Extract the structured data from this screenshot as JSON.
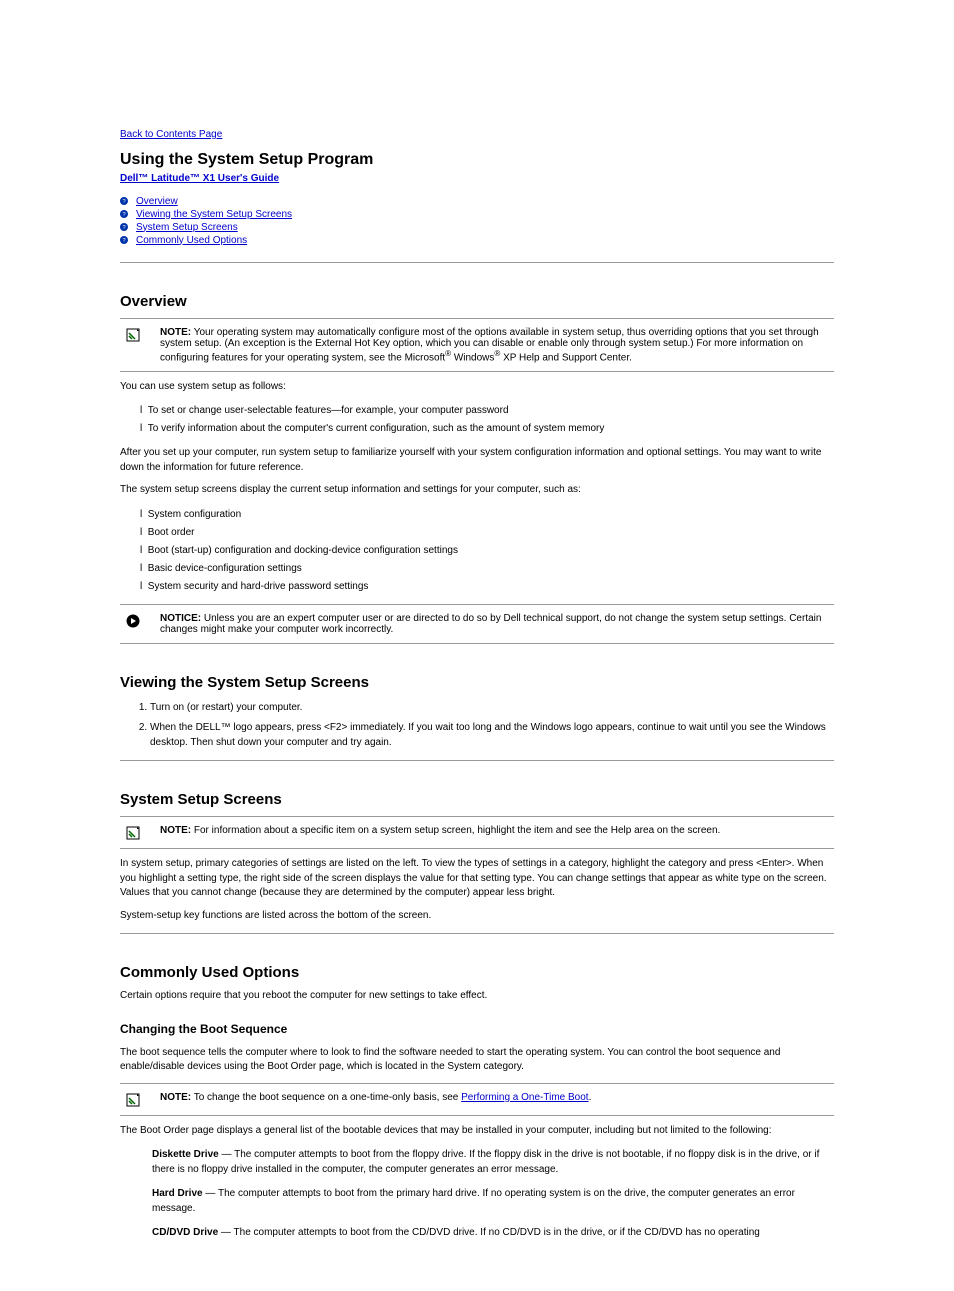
{
  "back_link": "Back to Contents Page",
  "main_title": "Using the System Setup Program",
  "guide_title": "Dell™ Latitude™ X1 User's Guide",
  "toc": [
    "Overview",
    "Viewing the System Setup Screens",
    "System Setup Screens",
    "Commonly Used Options"
  ],
  "overview": {
    "heading": "Overview",
    "note_label": "NOTE:",
    "note_text": " Your operating system may automatically configure most of the options available in system setup, thus overriding options that you set through system setup. (An exception is the External Hot Key option, which you can disable or enable only through system setup.) For more information on configuring features for your operating system, see the Microsoft",
    "note_reg1": "®",
    "note_mid": " Windows",
    "note_reg2": "®",
    "note_tail": " XP Help and Support Center.",
    "use_intro": "You can use system setup as follows:",
    "uses": [
      "To set or change user-selectable features—for example, your computer password",
      "To verify information about the computer's current configuration, such as the amount of system memory"
    ],
    "after": "After you set up your computer, run system setup to familiarize yourself with your system configuration information and optional settings. You may want to write down the information for future reference.",
    "contain_intro": "The system setup screens display the current setup information and settings for your computer, such as:",
    "contains": [
      "System configuration",
      "Boot order",
      "Boot (start-up) configuration and docking-device configuration settings",
      "Basic device-configuration settings",
      "System security and hard-drive password settings"
    ],
    "notice_label": "NOTICE:",
    "notice_text": " Unless you are an expert computer user or are directed to do so by Dell technical support, do not change the system setup settings. Certain changes might make your computer work incorrectly."
  },
  "viewing": {
    "heading": "Viewing the System Setup Screens",
    "steps": [
      "Turn on (or restart) your computer.",
      "When the DELL™ logo appears, press <F2> immediately. If you wait too long and the Windows logo appears, continue to wait until you see the Windows desktop. Then shut down your computer and try again."
    ]
  },
  "screens": {
    "heading": "System Setup Screens",
    "note_label": "NOTE:",
    "note_text": " For information about a specific item on a system setup screen, highlight the item and see the Help area on the screen.",
    "p1": "In system setup, primary categories of settings are listed on the left. To view the types of settings in a category, highlight the category and press <Enter>. When you highlight a setting type, the right side of the screen displays the value for that setting type. You can change settings that appear as white type on the screen. Values that you cannot change (because they are determined by the computer) appear less bright.",
    "p2": "System-setup key functions are listed across the bottom of the screen."
  },
  "common": {
    "heading": "Commonly Used Options",
    "restart_note": "Certain options require that you reboot the computer for new settings to take effect.",
    "sub_boot": "Changing the Boot Sequence",
    "boot_intro": "The boot sequence tells the computer where to look to find the software needed to start the operating system. You can control the boot sequence and enable/disable devices using the Boot Order page, which is located in the System category.",
    "boot_note_label": "NOTE:",
    "boot_note_text": " To change the boot sequence on a one-time-only basis, see ",
    "boot_note_link": "Performing a One-Time Boot",
    "boot_list_intro": "The Boot Order page displays a general list of the bootable devices that may be installed in your computer, including but not limited to the following:",
    "options": [
      {
        "name": "Diskette Drive",
        "desc": "The computer attempts to boot from the floppy drive. If the floppy disk in the drive is not bootable, if no floppy disk is in the drive, or if there is no floppy drive installed in the computer, the computer generates an error message."
      },
      {
        "name": "Hard Drive",
        "desc": "The computer attempts to boot from the primary hard drive. If no operating system is on the drive, the computer generates an error message."
      },
      {
        "name": "CD/DVD Drive",
        "desc": "The computer attempts to boot from the CD/DVD drive. If no CD/DVD is in the drive, or if the CD/DVD has no operating"
      }
    ]
  }
}
